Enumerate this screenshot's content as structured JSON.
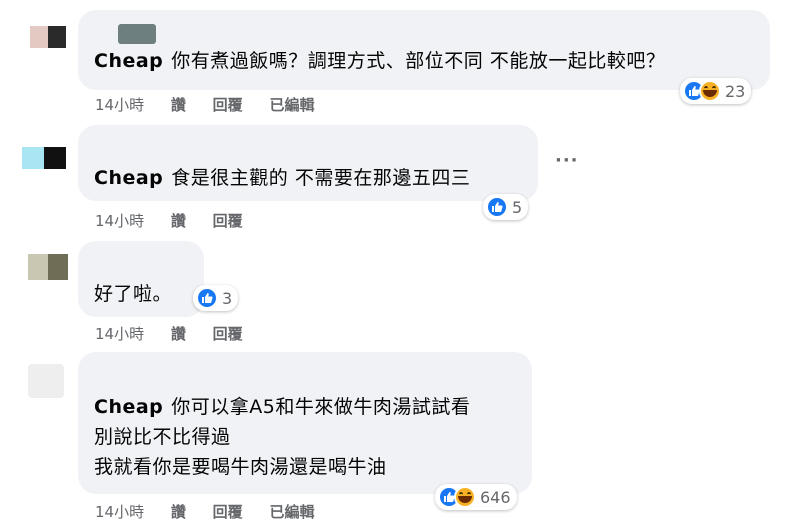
{
  "comments": [
    {
      "author": "Cheap",
      "lines": [
        "你有煮過飯嗎？調理方式、部位不同 不能放一起比較吧？"
      ],
      "time": "14小時",
      "actions": [
        "讚",
        "回覆",
        "已編輯"
      ],
      "reaction_icons": [
        "like-icon",
        "haha-icon"
      ],
      "reaction_count": "23"
    },
    {
      "author": "Cheap",
      "lines": [
        "食是很主觀的 不需要在那邊五四三"
      ],
      "time": "14小時",
      "actions": [
        "讚",
        "回覆"
      ],
      "reaction_icons": [
        "like-icon"
      ],
      "reaction_count": "5",
      "more_icon": "···"
    },
    {
      "author": "",
      "lines": [
        "好了啦。"
      ],
      "time": "14小時",
      "actions": [
        "讚",
        "回覆"
      ],
      "reaction_icons": [
        "like-icon"
      ],
      "reaction_count": "3"
    },
    {
      "author": "Cheap",
      "lines": [
        "你可以拿A5和牛來做牛肉湯試試看",
        "別說比不比得過",
        "我就看你是要喝牛肉湯還是喝牛油"
      ],
      "time": "14小時",
      "actions": [
        "讚",
        "回覆",
        "已編輯"
      ],
      "reaction_icons": [
        "like-icon",
        "haha-icon"
      ],
      "reaction_count": "646"
    }
  ],
  "colors": {
    "bubble": "#f0f2f5",
    "like": "#1877f2",
    "haha": "#f7b125",
    "meta": "#65676b"
  }
}
